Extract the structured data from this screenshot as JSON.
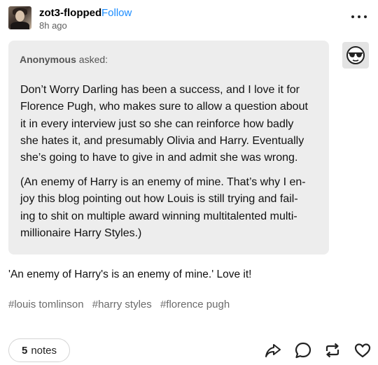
{
  "post": {
    "username": "zot3-flopped",
    "follow_label": "Follow",
    "timestamp": "8h ago",
    "more_icon": "more-dots-icon"
  },
  "ask": {
    "asker": "Anonymous",
    "asked_suffix": " asked:",
    "paragraph1_lines": [
      "Don’t Worry Darling has been a success, and I love it for",
      "Florence Pugh, who makes sure to allow a question about",
      "it in every interview just so she can reinforce how badly",
      "she hates it, and presumably Olivia and Harry. Eventually",
      "she’s going to have to give in and admit she was wrong."
    ],
    "paragraph2_lines": [
      "(An enemy of Harry is an enemy of mine. That’s why I en-",
      "joy this blog pointing out how Louis is still trying and fail-",
      "ing to shit on multiple award winning multitalented multi-",
      "millionaire Harry Styles.)"
    ],
    "avatar_icon": "sunglasses-face-icon"
  },
  "answer": {
    "text": "'An enemy of Harry's is an enemy of mine.' Love it!"
  },
  "tags": [
    "#louis tomlinson",
    "#harry styles",
    "#florence pugh"
  ],
  "footer": {
    "notes_count": "5",
    "notes_label": "notes",
    "actions": [
      "share-icon",
      "reply-icon",
      "reblog-icon",
      "like-icon"
    ]
  }
}
